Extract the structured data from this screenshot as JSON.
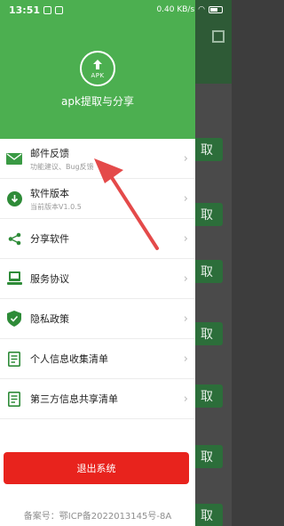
{
  "status_bar": {
    "time": "13:51",
    "net_speed": "0.40 KB/s"
  },
  "colors": {
    "green": "#4caf50",
    "red": "#e8231d",
    "arrow": "#e44a4a"
  },
  "drawer": {
    "logo_text": "APK",
    "title": "apk提取与分享",
    "menu": [
      {
        "icon": "mail-icon",
        "label": "邮件反馈",
        "sub": "功能建议、Bug反馈"
      },
      {
        "icon": "download-circle-icon",
        "label": "软件版本",
        "sub": "当前版本V1.0.5"
      },
      {
        "icon": "share-icon",
        "label": "分享软件",
        "sub": ""
      },
      {
        "icon": "service-agreement-icon",
        "label": "服务协议",
        "sub": ""
      },
      {
        "icon": "privacy-shield-icon",
        "label": "隐私政策",
        "sub": ""
      },
      {
        "icon": "document-list-icon",
        "label": "个人信息收集清单",
        "sub": ""
      },
      {
        "icon": "document-list-icon",
        "label": "第三方信息共享清单",
        "sub": ""
      }
    ],
    "logout_label": "退出系统",
    "icp": "备案号：鄂ICP备2022013145号-8A"
  },
  "background": {
    "button_label": "取"
  }
}
